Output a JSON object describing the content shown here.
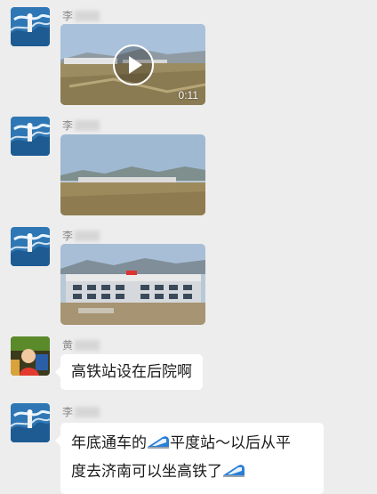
{
  "messages": [
    {
      "sender": "李",
      "type": "video",
      "duration": "0:11"
    },
    {
      "sender": "李",
      "type": "image"
    },
    {
      "sender": "李",
      "type": "image"
    },
    {
      "sender": "黄",
      "type": "text",
      "text": "高铁站设在后院啊"
    },
    {
      "sender": "李",
      "type": "text",
      "line1_a": "年底通车的",
      "line1_b": "平度站～以后从平",
      "line2": "度去济南可以坐高铁了"
    }
  ],
  "icons": {
    "emoji_train": "high-speed-train-icon",
    "play": "play-icon"
  },
  "colors": {
    "background": "#ededed",
    "bubble": "#ffffff",
    "sender_text": "#888888"
  }
}
